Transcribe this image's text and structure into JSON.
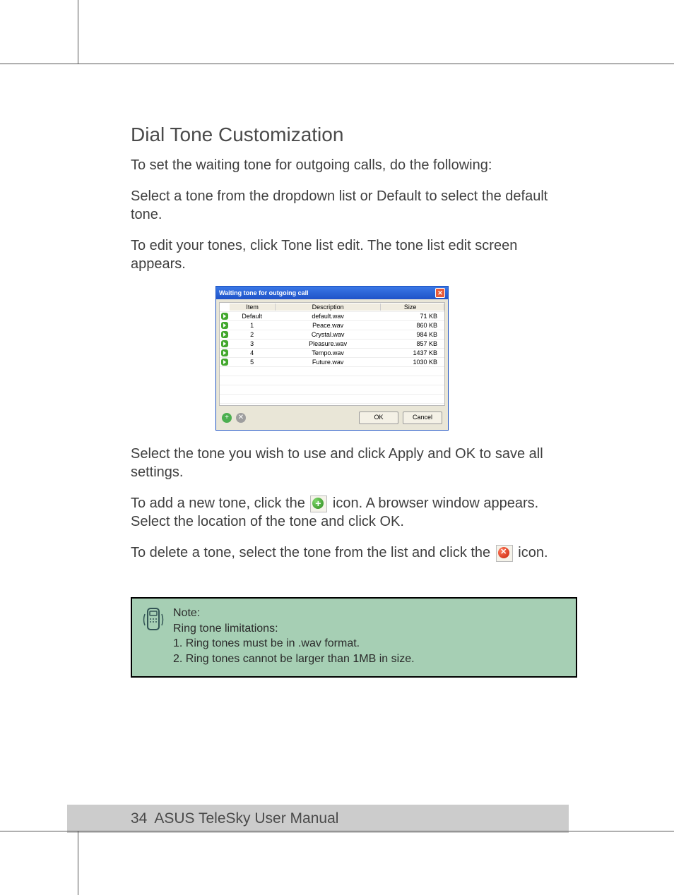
{
  "heading": "Dial Tone Customization",
  "para1": "To set the waiting tone for outgoing calls, do the following:",
  "para2": "Select a tone from the dropdown list or Default to select the default tone.",
  "para3": "To edit your tones, click Tone list edit. The tone list edit screen appears.",
  "dialog": {
    "title": "Waiting tone for outgoing call",
    "headers": {
      "item": "Item",
      "desc": "Description",
      "size": "Size"
    },
    "rows": [
      {
        "item": "Default",
        "desc": "default.wav",
        "size": "71 KB"
      },
      {
        "item": "1",
        "desc": "Peace.wav",
        "size": "860 KB"
      },
      {
        "item": "2",
        "desc": "Crystal.wav",
        "size": "984 KB"
      },
      {
        "item": "3",
        "desc": "Pleasure.wav",
        "size": "857 KB"
      },
      {
        "item": "4",
        "desc": "Tempo.wav",
        "size": "1437 KB"
      },
      {
        "item": "5",
        "desc": "Future.wav",
        "size": "1030 KB"
      }
    ],
    "ok": "OK",
    "cancel": "Cancel"
  },
  "para4": "Select the tone you wish to use and click Apply and OK to save all settings.",
  "para5a": "To add a new tone, click the ",
  "para5b": " icon. A browser window appears. Select the location of the tone and click OK.",
  "para6a": "To delete a tone, select the tone from the list and click the ",
  "para6b": " icon.",
  "note": {
    "title": "Note:",
    "sub": "Ring tone limitations:",
    "l1": "1. Ring tones must be in .wav format.",
    "l2": "2. Ring tones cannot be larger than 1MB in size."
  },
  "footer": {
    "page": "34",
    "title": "ASUS TeleSky User Manual"
  }
}
